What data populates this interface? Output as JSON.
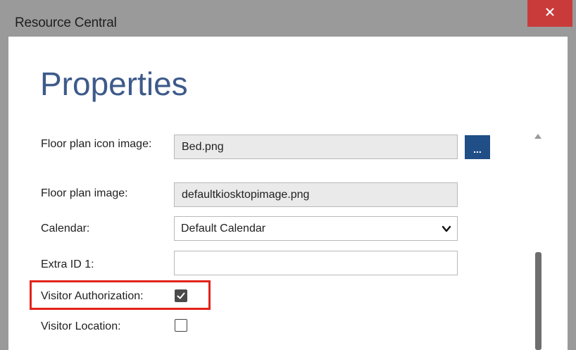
{
  "window": {
    "title": "Resource Central",
    "close_icon": "close-icon",
    "titlebar_color": "#9a9a9a",
    "close_color": "#c93b3b"
  },
  "page": {
    "title": "Properties",
    "title_color": "#3d5a8a"
  },
  "form": {
    "floor_plan_icon": {
      "label": "Floor plan icon image:",
      "value": "Bed.png",
      "browse_label": "..."
    },
    "floor_plan_image": {
      "label": "Floor plan image:",
      "value": "defaultkiosktopimage.png"
    },
    "calendar": {
      "label": "Calendar:",
      "selected": "Default Calendar",
      "icon": "chevron-down-icon"
    },
    "extra_id_1": {
      "label": "Extra ID 1:",
      "value": ""
    },
    "visitor_authorization": {
      "label": "Visitor Authorization:",
      "checked": true
    },
    "visitor_location": {
      "label": "Visitor Location:",
      "checked": false
    }
  },
  "annotation": {
    "highlight_color": "#e2231a"
  }
}
